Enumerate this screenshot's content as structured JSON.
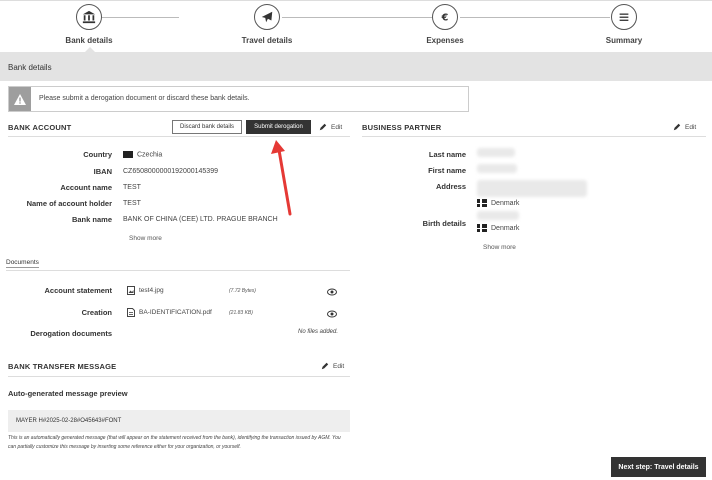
{
  "stepper": {
    "steps": [
      {
        "label": "Bank details",
        "icon": "bank-icon"
      },
      {
        "label": "Travel details",
        "icon": "plane-icon"
      },
      {
        "label": "Expenses",
        "icon": "euro-icon"
      },
      {
        "label": "Summary",
        "icon": "list-icon"
      }
    ]
  },
  "section_title": "Bank details",
  "warning": {
    "text": "Please submit a derogation document or discard these bank details."
  },
  "bank_account": {
    "title": "BANK ACCOUNT",
    "discard_label": "Discard bank details",
    "submit_label": "Submit derogation",
    "edit_label": "Edit",
    "fields": {
      "country_label": "Country",
      "country_value": "Czechia",
      "iban_label": "IBAN",
      "iban_value": "CZ6508000000192000145399",
      "account_name_label": "Account name",
      "account_name_value": "TEST",
      "holder_label": "Name of account holder",
      "holder_value": "TEST",
      "bank_name_label": "Bank name",
      "bank_name_value": "BANK OF CHINA (CEE) LTD. PRAGUE BRANCH"
    },
    "show_more": "Show more"
  },
  "business_partner": {
    "title": "BUSINESS PARTNER",
    "edit_label": "Edit",
    "last_name_label": "Last name",
    "first_name_label": "First name",
    "address_label": "Address",
    "address_country": "Denmark",
    "birth_label": "Birth details",
    "birth_country": "Denmark",
    "show_more": "Show more"
  },
  "documents": {
    "tab_label": "Documents",
    "account_statement_label": "Account statement",
    "account_statement_file": "test4.jpg",
    "account_statement_size": "(7.72 Bytes)",
    "creation_label": "Creation",
    "creation_file": "BA-IDENTIFICATION.pdf",
    "creation_size": "(21.83 KB)",
    "derogation_label": "Derogation documents",
    "derogation_value": "No files added."
  },
  "transfer": {
    "title": "BANK TRANSFER MESSAGE",
    "edit_label": "Edit",
    "preview_label": "Auto-generated message preview",
    "message": "MAYER H#2025-02-28#O45643#FONT",
    "note": "This is an automatically generated message (that will appear on the statement received from the bank), identifying the transaction issued by AGM. You can partially customize this message by inserting some reference either for your organization, or yourself."
  },
  "next_button": "Next step: Travel details",
  "colors": {
    "dark": "#333333",
    "section_bg": "#e3e3e3",
    "arrow": "#e53935"
  }
}
